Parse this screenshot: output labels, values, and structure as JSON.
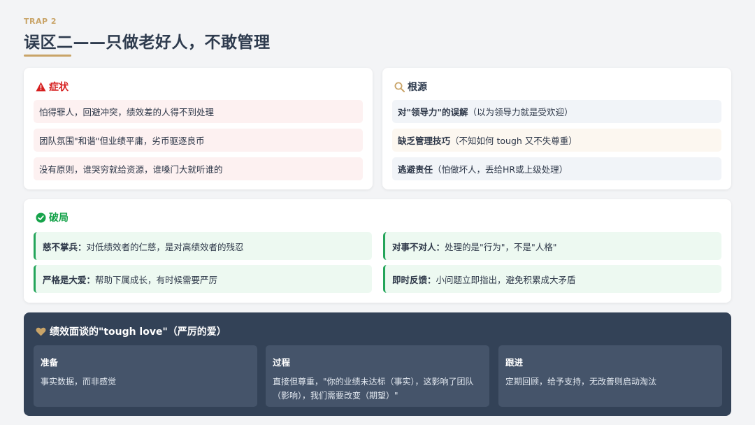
{
  "header": {
    "kicker": "TRAP 2",
    "title": "误区二——只做老好人，不敢管理"
  },
  "symptoms": {
    "title": "症状",
    "icon": "warning-icon",
    "color": "#d61f1f",
    "items": [
      "怕得罪人，回避冲突，绩效差的人得不到处理",
      "团队氛围\"和谐\"但业绩平庸，劣币驱逐良币",
      "没有原则，谁哭穷就给资源，谁嗓门大就听谁的"
    ]
  },
  "roots": {
    "title": "根源",
    "icon": "search-icon",
    "items": [
      {
        "bold": "对\"领导力\"的误解",
        "text": "（以为领导力就是受欢迎）"
      },
      {
        "bold": "缺乏管理技巧",
        "text": "（不知如何 tough 又不失尊重）"
      },
      {
        "bold": "逃避责任",
        "text": "（怕做坏人，丢给HR或上级处理）"
      }
    ]
  },
  "solutions": {
    "title": "破局",
    "icon": "check-circle-icon",
    "color": "#16a34a",
    "items": [
      {
        "bold": "慈不掌兵：",
        "text": "对低绩效者的仁慈，是对高绩效者的残忍"
      },
      {
        "bold": "对事不对人：",
        "text": "处理的是\"行为\"，不是\"人格\""
      },
      {
        "bold": "严格是大爱：",
        "text": "帮助下属成长，有时候需要严厉"
      },
      {
        "bold": "即时反馈：",
        "text": "小问题立即指出，避免积累成大矛盾"
      }
    ]
  },
  "tough_love": {
    "title": "绩效面谈的\"tough love\"（严厉的爱）",
    "icon": "heart-icon",
    "steps": [
      {
        "title": "准备",
        "text": "事实数据，而非感觉"
      },
      {
        "title": "过程",
        "text": "直接但尊重，\"你的业绩未达标（事实），这影响了团队（影响），我们需要改变（期望）\""
      },
      {
        "title": "跟进",
        "text": "定期回顾，给予支持，无改善则启动淘汰"
      }
    ]
  }
}
